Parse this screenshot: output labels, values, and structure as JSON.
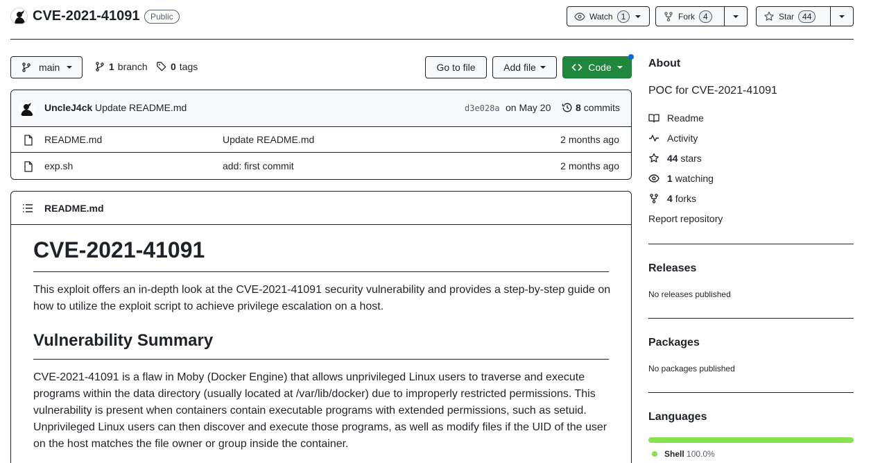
{
  "repo": {
    "name": "CVE-2021-41091",
    "visibility": "Public"
  },
  "header_actions": {
    "watch_label": "Watch",
    "watch_count": "1",
    "fork_label": "Fork",
    "fork_count": "4",
    "star_label": "Star",
    "star_count": "44"
  },
  "toolbar": {
    "branch": "main",
    "branch_count": "1",
    "branch_label": "branch",
    "tags_count": "0",
    "tags_label": "tags",
    "goto_file": "Go to file",
    "add_file": "Add file",
    "code": "Code"
  },
  "latest_commit": {
    "author": "UncleJ4ck",
    "message": "Update README.md",
    "hash": "d3e028a",
    "date": "on May 20",
    "commit_count": "8",
    "commit_label": "commits"
  },
  "files": [
    {
      "name": "README.md",
      "message": "Update README.md",
      "date": "2 months ago"
    },
    {
      "name": "exp.sh",
      "message": "add: first commit",
      "date": "2 months ago"
    }
  ],
  "readme": {
    "file_label": "README.md",
    "h1": "CVE-2021-41091",
    "intro": "This exploit offers an in-depth look at the CVE-2021-41091 security vulnerability and provides a step-by-step guide on how to utilize the exploit script to achieve privilege escalation on a host.",
    "h2": "Vulnerability Summary",
    "summary": "CVE-2021-41091 is a flaw in Moby (Docker Engine) that allows unprivileged Linux users to traverse and execute programs within the data directory (usually located at /var/lib/docker) due to improperly restricted permissions. This vulnerability is present when containers contain executable programs with extended permissions, such as setuid. Unprivileged Linux users can then discover and execute those programs, as well as modify files if the UID of the user on the host matches the file owner or group inside the container."
  },
  "sidebar": {
    "about_title": "About",
    "description": "POC for CVE-2021-41091",
    "readme": "Readme",
    "activity": "Activity",
    "stars_count": "44",
    "stars_label": "stars",
    "watching_count": "1",
    "watching_label": "watching",
    "forks_count": "4",
    "forks_label": "forks",
    "report": "Report repository",
    "releases_title": "Releases",
    "releases_empty": "No releases published",
    "packages_title": "Packages",
    "packages_empty": "No packages published",
    "languages_title": "Languages",
    "language_name": "Shell",
    "language_percent": "100.0%",
    "language_fraction": 1.0
  },
  "colors": {
    "code_button": "#1f883d",
    "language_shell": "#89e051",
    "notification_dot": "#0969da"
  }
}
